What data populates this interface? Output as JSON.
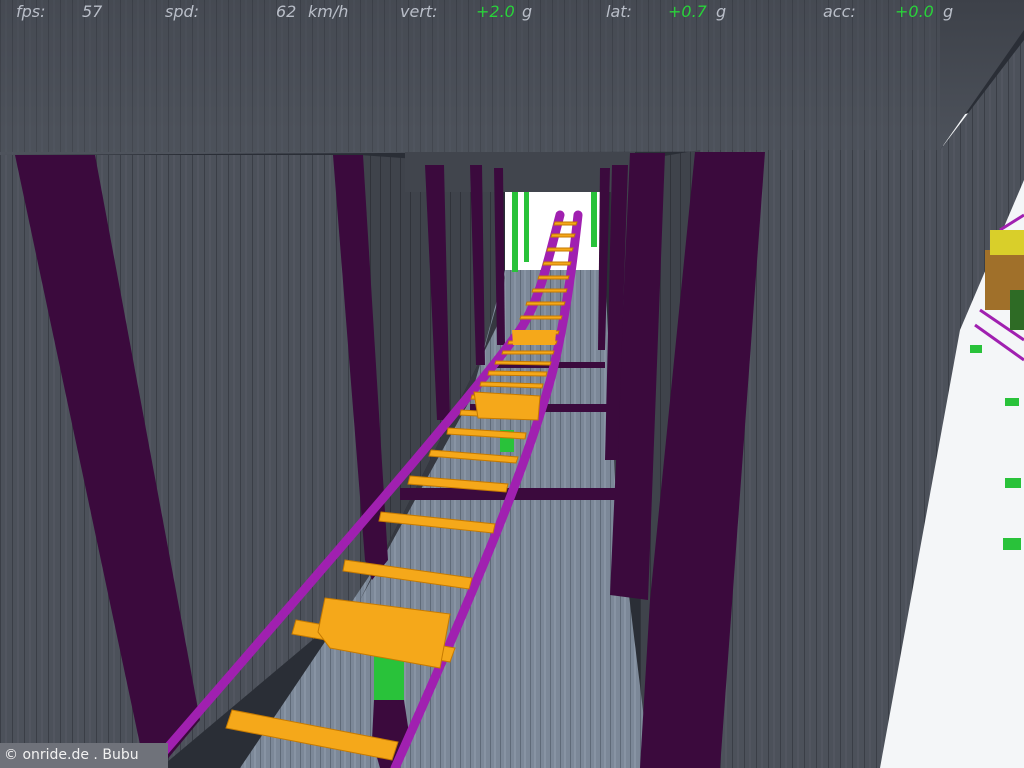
{
  "hud": {
    "fps_label": "fps:",
    "fps_value": "57",
    "spd_label": "spd:",
    "spd_value": "62",
    "spd_unit": "km/h",
    "vert_label": "vert:",
    "vert_value": "+2.0",
    "vert_unit": "g",
    "lat_label": "lat:",
    "lat_value": "+0.7",
    "lat_unit": "g",
    "acc_label": "acc:",
    "acc_value": "+0.0",
    "acc_unit": "g"
  },
  "credit": "© onride.de . Bubu",
  "colors": {
    "wall": "#4a4f58",
    "beam": "#3b0a3d",
    "rail": "#a020b0",
    "tie": "#f5a81a",
    "support": "#29c23a",
    "floor": "#7e8a9a",
    "sky": "#ffffff"
  }
}
